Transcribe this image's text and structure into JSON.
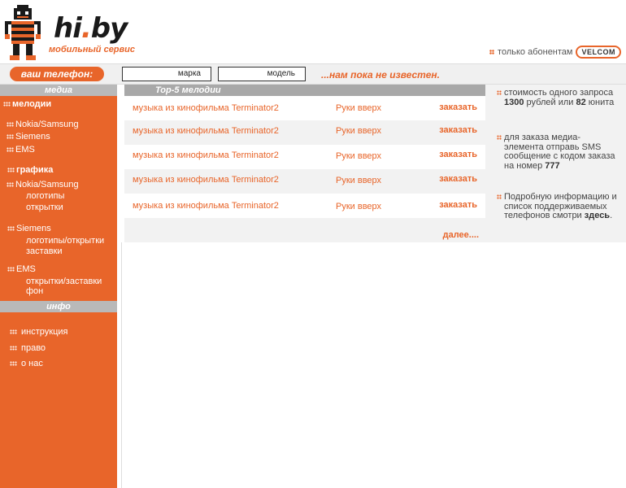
{
  "header": {
    "logo_text_main": "hi",
    "logo_text_dot": ".",
    "logo_text_end": "by",
    "logo_subtitle": "мобильный сервис",
    "subscribers_label": "только абонентам",
    "operator_badge": "VELCOM"
  },
  "phonebar": {
    "label": "ваш телефон:",
    "brand_value": "марка",
    "model_value": "модель",
    "status": "...нам пока не известен."
  },
  "sidebar": {
    "media_heading": "медиа",
    "melodies_heading": "мелодии",
    "melodies_items": [
      "Nokia/Samsung",
      "Siemens",
      "EMS"
    ],
    "graphics_heading": "графика",
    "graphics_groups": [
      {
        "name": "Nokia/Samsung",
        "subs": [
          "логотипы",
          "открытки"
        ]
      },
      {
        "name": "Siemens",
        "subs": [
          "логотипы/открытки",
          "заставки"
        ]
      },
      {
        "name": "EMS",
        "subs": [
          "открытки/заставки",
          "фон"
        ]
      }
    ],
    "info_heading": "инфо",
    "info_items": [
      "инструкция",
      "право",
      "о нас"
    ]
  },
  "main": {
    "heading": "Top-5 мелодии",
    "rows": [
      {
        "title": "музыка из кинофильма Terminator2",
        "artist": "Руки вверх",
        "order": "заказать"
      },
      {
        "title": "музыка из кинофильма Terminator2",
        "artist": "Руки вверх",
        "order": "заказать"
      },
      {
        "title": "музыка из кинофильма Terminator2",
        "artist": "Руки вверх",
        "order": "заказать"
      },
      {
        "title": "музыка из кинофильма Terminator2",
        "artist": "Руки вверх",
        "order": "заказать"
      },
      {
        "title": "музыка из кинофильма Terminator2",
        "artist": "Руки вверх",
        "order": "заказать"
      }
    ],
    "more_link": "далее...."
  },
  "info_panel": {
    "price_pre": "стоимость одного запроса ",
    "price_value": "1300",
    "price_mid": " рублей или ",
    "price_units": "82",
    "price_post": " юнита",
    "order_text": "для заказа медиа-элемента отправь SMS сообщение с кодом заказа на номер ",
    "order_number": "777",
    "support_text": "Подробную информацию и список поддерживаемых телефонов смотри ",
    "support_link": "здесь",
    "support_end": "."
  },
  "colors": {
    "accent": "#e8652a",
    "heading_bar": "#a8a8a8",
    "row_alt": "#f2f2f2"
  }
}
